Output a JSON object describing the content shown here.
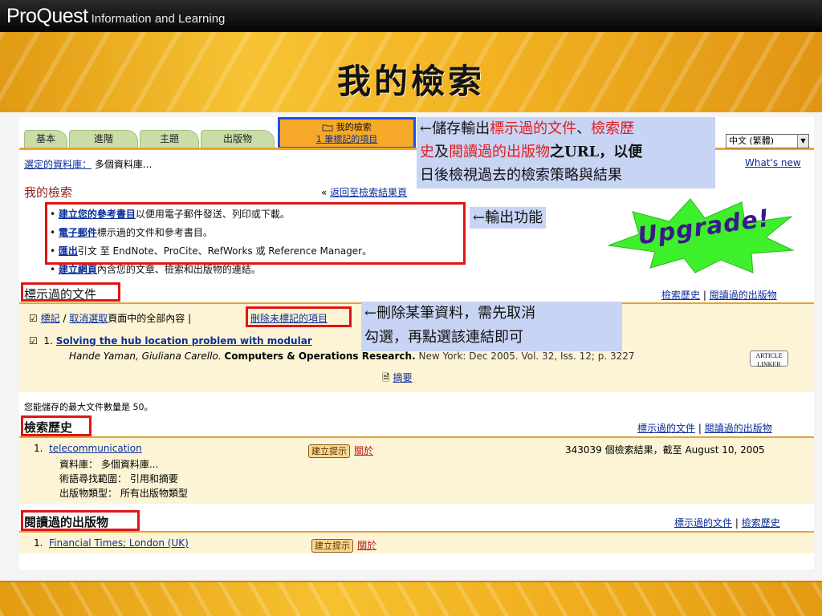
{
  "slide": {
    "brand_main": "ProQuest",
    "brand_sub": "Information and Learning",
    "title": "我的檢索"
  },
  "tabs": {
    "items": [
      "基本",
      "進階",
      "主題",
      "出版物"
    ],
    "active_line1": "我的檢索",
    "active_line2": "1 筆標記的項目"
  },
  "language": {
    "selected": "中文 (繁體)"
  },
  "header": {
    "selected_db_label": "選定的資料庫：",
    "selected_db_value": "多個資料庫...",
    "whats_new": "What's new"
  },
  "my_search": {
    "title": "我的檢索",
    "back_link": "返回至檢索結果頁",
    "back_prefix": "«",
    "bullets": [
      {
        "link": "建立您的參考書目",
        "text": "以便用電子郵件發送、列印或下載。"
      },
      {
        "link": "電子郵件",
        "text": "標示過的文件和參考書目。"
      },
      {
        "link": "匯出",
        "text": "引文 至 EndNote、ProCite、RefWorks 或 Reference Manager。"
      },
      {
        "link": "建立網頁",
        "text": "內含您的文章、檢索和出版物的連結。"
      }
    ]
  },
  "marked_docs": {
    "title": "標示過的文件",
    "nav_history": "檢索歷史",
    "nav_read": "閱讀過的出版物",
    "mark_link": "標記",
    "unmark_link": "取消選取",
    "toolbar_text": "頁面中的全部內容",
    "delete_link": "刪除未標記的項目",
    "item": {
      "number": "1.",
      "title": "Solving the hub location problem with modular",
      "authors": "Hande Yaman, Giuliana Carello.",
      "journal": "Computers & Operations Research.",
      "details": "New York: Dec 2005. Vol. 32, Iss. 12; p. 3227",
      "abstract_link": "摘要",
      "badge": "ARTICLE LINKER"
    },
    "max_note": "您能儲存的最大文件數量是 50。"
  },
  "history": {
    "title": "檢索歷史",
    "nav_marked": "標示過的文件",
    "nav_read": "閱讀過的出版物",
    "item": {
      "number": "1.",
      "query": "telecommunication",
      "create_alert": "建立提示",
      "about": "關於",
      "result": "343039 個檢索結果，截至 August 10, 2005",
      "db_line": "資料庫： 多個資料庫...",
      "scope_line": "術語尋找範圍： 引用和摘要",
      "type_line": "出版物類型： 所有出版物類型"
    }
  },
  "read_pubs": {
    "title": "閱讀過的出版物",
    "nav_marked": "標示過的文件",
    "nav_history": "檢索歷史",
    "item": {
      "number": "1.",
      "title": "Financial Times; London (UK)",
      "create_alert": "建立提示",
      "about": "關於"
    }
  },
  "callouts": {
    "save_arrow": "←儲存輸出",
    "save_red1": "標示過的文件",
    "save_sep": "、",
    "save_red2": "檢索歷",
    "save_red3": "史",
    "save_mid": "及",
    "save_red4": "閱讀過的出版物",
    "save_mid2": "之URL，以便",
    "save_line3": "日後檢視過去的檢索策略與結果",
    "export": "←輸出功能",
    "delete_line1": "←刪除某筆資料，需先取消",
    "delete_line2": "勾選，再點選該連結即可",
    "upgrade": "Upgrade!"
  },
  "colors": {
    "accent_red": "#e01515",
    "callout_blue_bg": "#c8d4f4",
    "tab_orange": "#f6a928",
    "gold": "#f2b222",
    "link_blue": "#0b2e99"
  }
}
